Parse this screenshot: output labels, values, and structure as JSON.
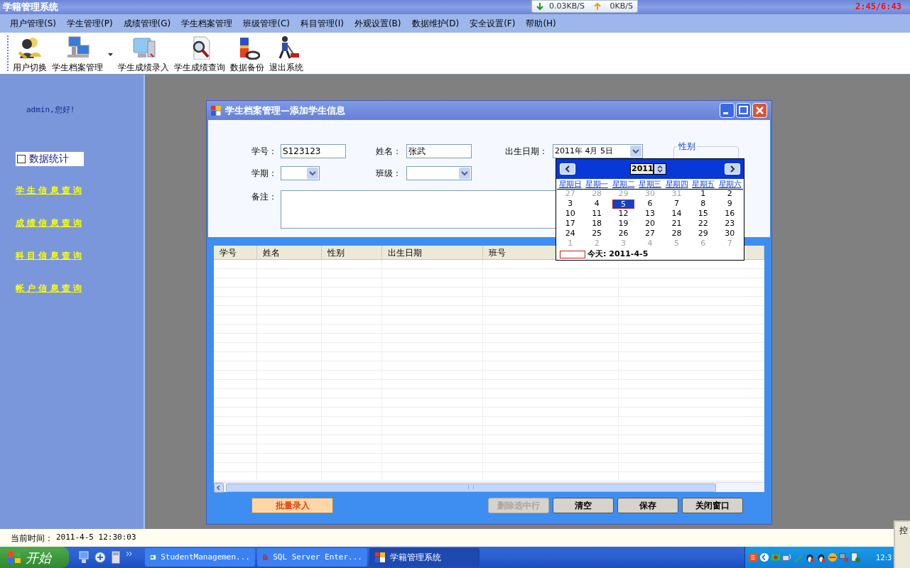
{
  "title_bar": {
    "title": "学籍管理系统",
    "download": "0.03KB/S",
    "upload": "0KB/S",
    "timer": "2:45/6:43"
  },
  "menu": [
    "用户管理(S)",
    "学生管理(P)",
    "成绩管理(G)",
    "学生档案管理",
    "班级管理(C)",
    "科目管理(I)",
    "外观设置(B)",
    "数据维护(D)",
    "安全设置(F)",
    "帮助(H)"
  ],
  "toolbar": [
    {
      "label": "用户切换",
      "dropdown": false
    },
    {
      "label": "学生档案管理",
      "dropdown": true
    },
    {
      "label": "学生成绩录入",
      "dropdown": false
    },
    {
      "label": "学生成绩查询",
      "dropdown": false
    },
    {
      "label": "数据备份",
      "dropdown": false
    },
    {
      "label": "退出系统",
      "dropdown": false
    }
  ],
  "sidebar": {
    "greeting": "admin,您好!",
    "stats": {
      "label": "数据统计",
      "checked": false
    },
    "links": [
      "学 生 信 息 查 询",
      "成 绩 信 息 查 询",
      "科 目 信 息 查 询",
      "帐 户 信 息 查 询"
    ]
  },
  "dialog": {
    "title": "学生档案管理—添加学生信息",
    "form": {
      "student_id": {
        "label": "学号：",
        "value": "S123123"
      },
      "name": {
        "label": "姓名：",
        "value": "张武"
      },
      "birth_date": {
        "label": "出生日期：",
        "value": "2011年 4月 5日"
      },
      "term": {
        "label": "学期："
      },
      "class": {
        "label": "班级："
      },
      "remarks": {
        "label": "备注："
      },
      "gender": {
        "legend": "性别"
      }
    },
    "calendar": {
      "year": "2011",
      "weekdays": [
        "星期日",
        "星期一",
        "星期二",
        "星期三",
        "星期四",
        "星期五",
        "星期六"
      ],
      "weeks": [
        [
          {
            "day": "27",
            "other_month": true,
            "selected": false
          },
          {
            "day": "28",
            "other_month": true,
            "selected": false
          },
          {
            "day": "29",
            "other_month": true,
            "selected": false
          },
          {
            "day": "30",
            "other_month": true,
            "selected": false
          },
          {
            "day": "31",
            "other_month": true,
            "selected": false
          },
          {
            "day": "1",
            "other_month": false,
            "selected": false
          },
          {
            "day": "2",
            "other_month": false,
            "selected": false
          }
        ],
        [
          {
            "day": "3",
            "other_month": false,
            "selected": false
          },
          {
            "day": "4",
            "other_month": false,
            "selected": false
          },
          {
            "day": "5",
            "other_month": false,
            "selected": true
          },
          {
            "day": "6",
            "other_month": false,
            "selected": false
          },
          {
            "day": "7",
            "other_month": false,
            "selected": false
          },
          {
            "day": "8",
            "other_month": false,
            "selected": false
          },
          {
            "day": "9",
            "other_month": false,
            "selected": false
          }
        ],
        [
          {
            "day": "10",
            "other_month": false,
            "selected": false
          },
          {
            "day": "11",
            "other_month": false,
            "selected": false
          },
          {
            "day": "12",
            "other_month": false,
            "selected": false
          },
          {
            "day": "13",
            "other_month": false,
            "selected": false
          },
          {
            "day": "14",
            "other_month": false,
            "selected": false
          },
          {
            "day": "15",
            "other_month": false,
            "selected": false
          },
          {
            "day": "16",
            "other_month": false,
            "selected": false
          }
        ],
        [
          {
            "day": "17",
            "other_month": false,
            "selected": false
          },
          {
            "day": "18",
            "other_month": false,
            "selected": false
          },
          {
            "day": "19",
            "other_month": false,
            "selected": false
          },
          {
            "day": "20",
            "other_month": false,
            "selected": false
          },
          {
            "day": "21",
            "other_month": false,
            "selected": false
          },
          {
            "day": "22",
            "other_month": false,
            "selected": false
          },
          {
            "day": "23",
            "other_month": false,
            "selected": false
          }
        ],
        [
          {
            "day": "24",
            "other_month": false,
            "selected": false
          },
          {
            "day": "25",
            "other_month": false,
            "selected": false
          },
          {
            "day": "26",
            "other_month": false,
            "selected": false
          },
          {
            "day": "27",
            "other_month": false,
            "selected": false
          },
          {
            "day": "28",
            "other_month": false,
            "selected": false
          },
          {
            "day": "29",
            "other_month": false,
            "selected": false
          },
          {
            "day": "30",
            "other_month": false,
            "selected": false
          }
        ],
        [
          {
            "day": "1",
            "other_month": true,
            "selected": false
          },
          {
            "day": "2",
            "other_month": true,
            "selected": false
          },
          {
            "day": "3",
            "other_month": true,
            "selected": false
          },
          {
            "day": "4",
            "other_month": true,
            "selected": false
          },
          {
            "day": "5",
            "other_month": true,
            "selected": false
          },
          {
            "day": "6",
            "other_month": true,
            "selected": false
          },
          {
            "day": "7",
            "other_month": true,
            "selected": false
          }
        ]
      ],
      "today": "今天: 2011-4-5"
    },
    "table": {
      "columns": [
        "学号",
        "姓名",
        "性别",
        "出生日期",
        "班号"
      ]
    },
    "batch_button": "批量录入",
    "buttons": [
      {
        "label": "删除选中行",
        "disabled": true
      },
      {
        "label": "清空",
        "disabled": false
      },
      {
        "label": "保存",
        "disabled": false
      },
      {
        "label": "关闭窗口",
        "disabled": false
      }
    ]
  },
  "status_bar": {
    "label": "当前时间：",
    "value": "2011-4-5 12:30:03"
  },
  "taskbar": {
    "start": "开始",
    "tasks": [
      {
        "label": "StudentManagemen...",
        "selected": false
      },
      {
        "label": "SQL Server Enter...",
        "selected": false
      },
      {
        "label": "学籍管理系统",
        "selected": true
      }
    ],
    "clock": "12:3"
  },
  "corner_window": {
    "title": "控"
  }
}
